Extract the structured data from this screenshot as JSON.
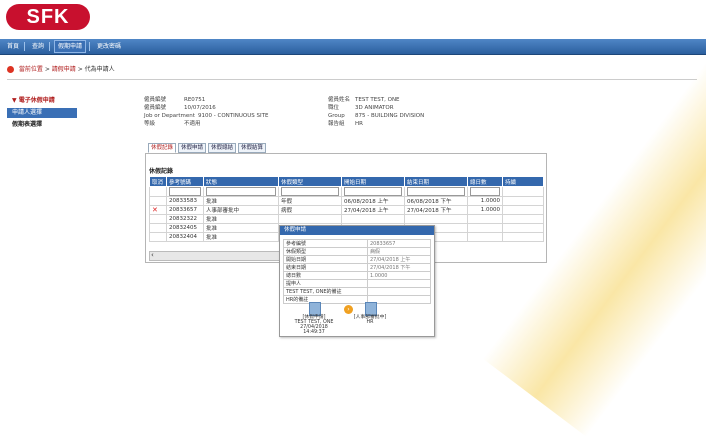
{
  "logo_text": "SFK",
  "nav": {
    "items": [
      "首頁",
      "查詢",
      "假期申請",
      "更改密碼"
    ],
    "active_index": 2
  },
  "breadcrumb": {
    "home": "當前位置",
    "level1": "請假申請",
    "level2": "代為申請人"
  },
  "sidebar": {
    "heading": "▼ 電子休假申請",
    "items": [
      "申請人選擇",
      "假期表選擇"
    ]
  },
  "employee": {
    "left": [
      {
        "label": "僱員編號",
        "value": "RE0751"
      },
      {
        "label": "僱員編號",
        "value": "10/07/2016"
      },
      {
        "label": "Job or Department",
        "value": "9100 - CONTINUOUS SITE"
      },
      {
        "label": "等級",
        "value": "不適用"
      }
    ],
    "right": [
      {
        "label": "僱員姓名",
        "value": "TEST TEST, ONE"
      },
      {
        "label": "職位",
        "value": "3D ANIMATOR"
      },
      {
        "label": "Group",
        "value": "875 - BUILDING DIVISION"
      },
      {
        "label": "報告組",
        "value": "HR"
      }
    ]
  },
  "tabs": [
    "休假記錄",
    "休假申請",
    "休假總結",
    "休假結算"
  ],
  "records": {
    "title": "休假記錄",
    "headers": [
      "取消",
      "參考號碼",
      "狀態",
      "休假類型",
      "開始日期",
      "結束日期",
      "總日數",
      "持續"
    ],
    "rows": [
      {
        "cancel": "",
        "ref": "20833583",
        "status": "批准",
        "type": "年假",
        "start": "06/08/2018 上午",
        "end": "06/08/2018 下午",
        "days": "1.0000"
      },
      {
        "cancel": "✕",
        "ref": "20833657",
        "status": "人事部審批中",
        "type": "病假",
        "start": "27/04/2018 上午",
        "end": "27/04/2018 下午",
        "days": "1.0000"
      },
      {
        "cancel": "",
        "ref": "20832322",
        "status": "批准",
        "type": "",
        "start": "",
        "end": "",
        "days": ""
      },
      {
        "cancel": "",
        "ref": "20832405",
        "status": "批准",
        "type": "",
        "start": "",
        "end": "",
        "days": ""
      },
      {
        "cancel": "",
        "ref": "20832404",
        "status": "批准",
        "type": "",
        "start": "",
        "end": "",
        "days": ""
      }
    ]
  },
  "popup": {
    "title": "休假申請",
    "rows": [
      {
        "label": "參考編號",
        "value": "20833657"
      },
      {
        "label": "休假類型",
        "value": "病假"
      },
      {
        "label": "開始日期",
        "value": "27/04/2018 上午"
      },
      {
        "label": "結束日期",
        "value": "27/04/2018 下午"
      },
      {
        "label": "總日數",
        "value": "1.0000"
      },
      {
        "label": "提申人",
        "value": ""
      },
      {
        "label": "TEST TEST, ONE的備註",
        "value": ""
      },
      {
        "label": "HR的備註",
        "value": ""
      }
    ],
    "flow_left": [
      "[休假申請]",
      "TEST TEST, ONE",
      "27/04/2018 14:49:37"
    ],
    "flow_right": [
      "[人事部審批中]",
      "HR"
    ]
  }
}
